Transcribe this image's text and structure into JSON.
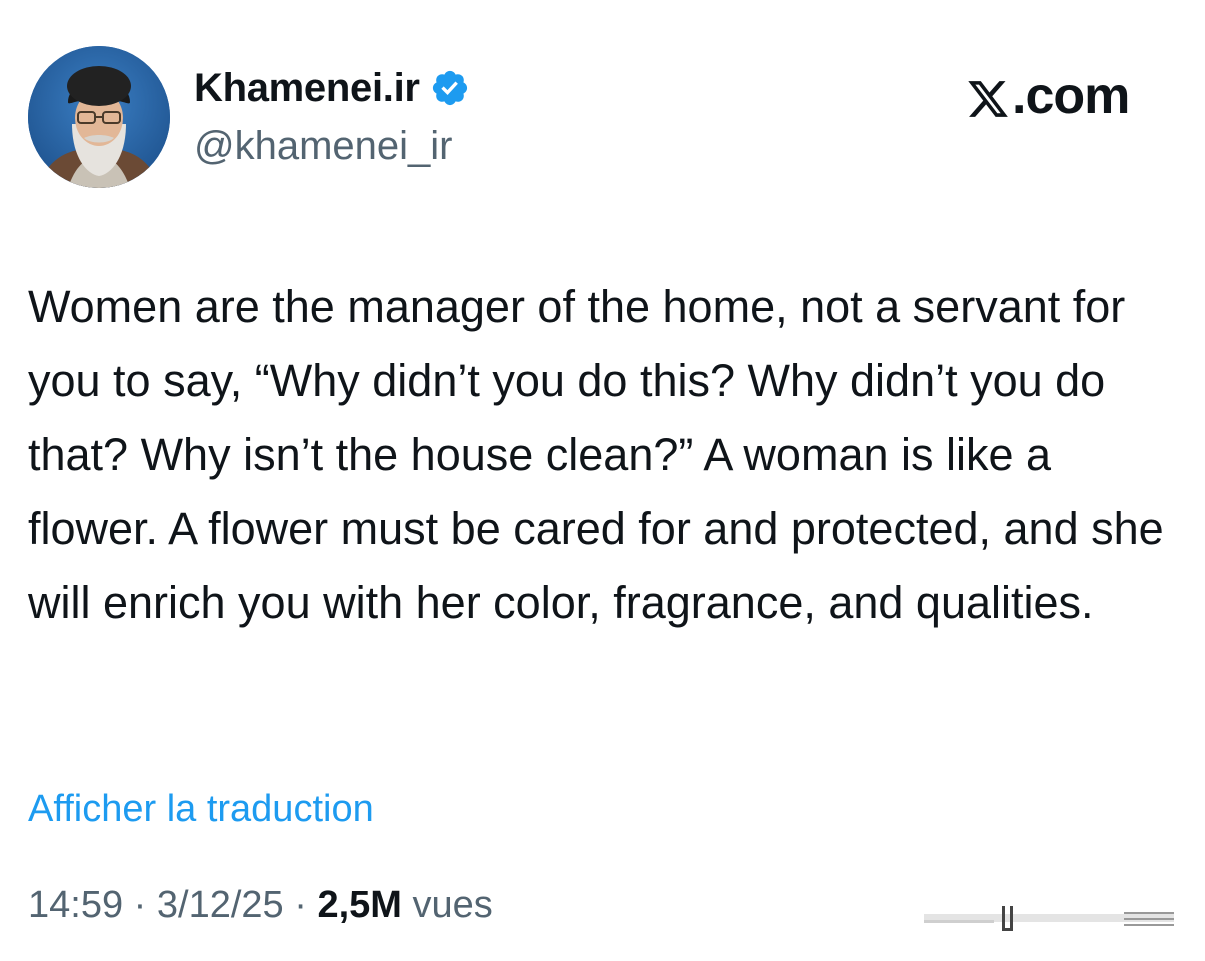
{
  "author": {
    "name": "Khamenei.ir",
    "handle": "@khamenei_ir",
    "verified": true,
    "verified_color": "#1d9bf0"
  },
  "brand": {
    "logo_text": ".com",
    "logo_icon": "x-logo-icon"
  },
  "tweet": {
    "text": "Women are the manager of the home, not a servant for you to say, “Why didn’t you do this? Why didn’t you do that? Why isn’t the house clean?” A woman is like a flower. A flower must be cared for and protected, and she will enrich you with her color, fragrance, and qualities.",
    "translate_label": "Afficher la traduction",
    "time": "14:59",
    "separator": "·",
    "date": "3/12/25",
    "views_count": "2,5M",
    "views_label": "vues"
  },
  "colors": {
    "link": "#1d9bf0",
    "text": "#0f1419",
    "secondary": "#536471"
  }
}
